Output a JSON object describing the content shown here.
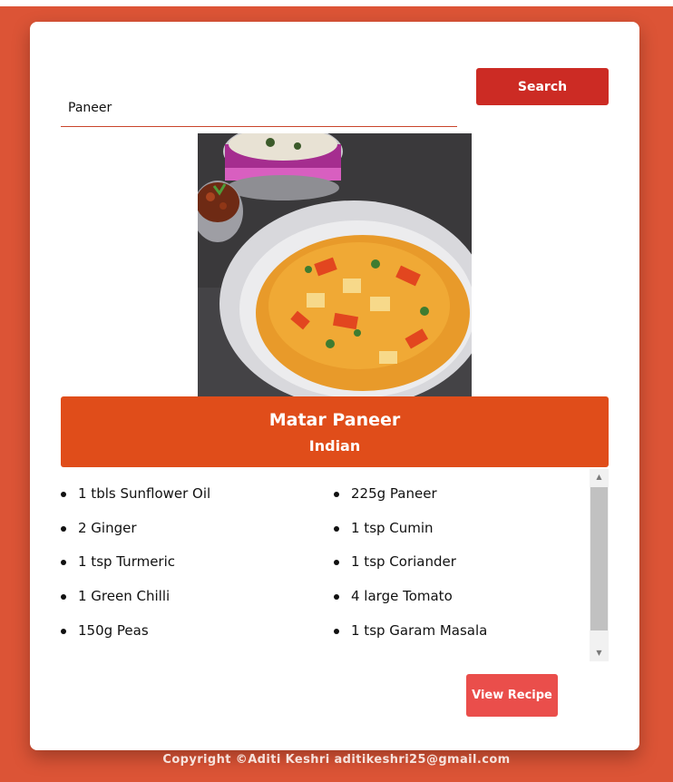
{
  "search": {
    "value": "Paneer",
    "button_label": "Search"
  },
  "recipe": {
    "title": "Matar Paneer",
    "cuisine": "Indian",
    "image_alt": "Matar Paneer",
    "ingredients": [
      "1 tbls Sunflower Oil",
      "225g Paneer",
      "2 Ginger",
      "1 tsp Cumin",
      "1 tsp Turmeric",
      "1 tsp Coriander",
      "1 Green Chilli",
      "4 large Tomato",
      "150g Peas",
      "1 tsp Garam Masala"
    ],
    "view_button_label": "View Recipe"
  },
  "footer": {
    "text": "Copyright ©Aditi Keshri aditikeshri25@gmail.com"
  },
  "colors": {
    "page_background": "#dc5436",
    "search_button": "#cc2b24",
    "header_band": "#e04d1a",
    "view_button": "#ea4e4b"
  },
  "icons": {
    "scroll_up": "scroll-up-arrow-icon",
    "scroll_down": "scroll-down-arrow-icon"
  }
}
